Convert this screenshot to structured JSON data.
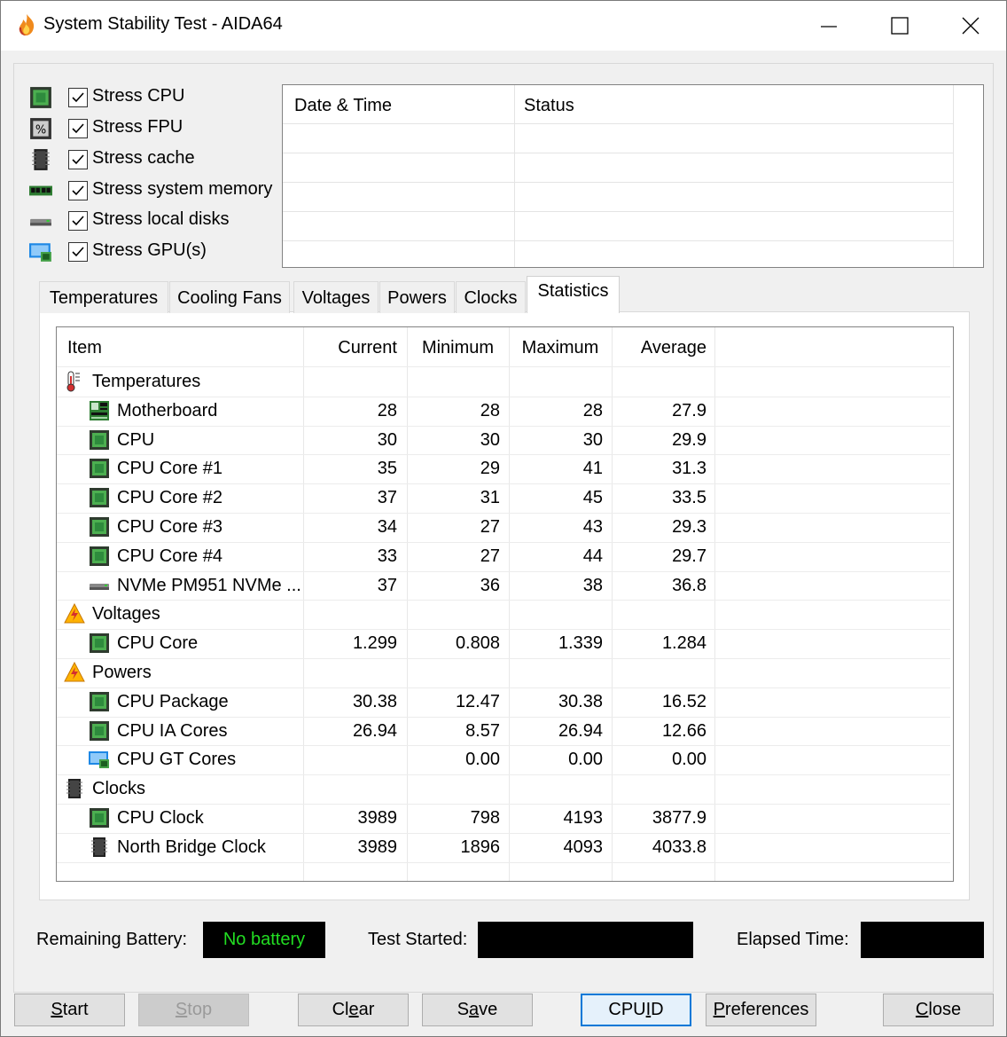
{
  "window": {
    "title": "System Stability Test - AIDA64",
    "icon": "aida64-flame-icon"
  },
  "stress_options": [
    {
      "label": "Stress CPU",
      "checked": true,
      "icon": "cpu-chip-icon"
    },
    {
      "label": "Stress FPU",
      "checked": true,
      "icon": "fpu-chip-icon"
    },
    {
      "label": "Stress cache",
      "checked": true,
      "icon": "cache-chip-icon"
    },
    {
      "label": "Stress system memory",
      "checked": true,
      "icon": "memory-module-icon"
    },
    {
      "label": "Stress local disks",
      "checked": true,
      "icon": "disk-drive-icon"
    },
    {
      "label": "Stress GPU(s)",
      "checked": true,
      "icon": "gpu-monitor-icon"
    }
  ],
  "status_log": {
    "columns": [
      "Date & Time",
      "Status"
    ],
    "rows": []
  },
  "tabs": [
    {
      "label": "Temperatures",
      "active": false
    },
    {
      "label": "Cooling Fans",
      "active": false
    },
    {
      "label": "Voltages",
      "active": false
    },
    {
      "label": "Powers",
      "active": false
    },
    {
      "label": "Clocks",
      "active": false
    },
    {
      "label": "Statistics",
      "active": true
    }
  ],
  "statistics": {
    "columns": [
      "Item",
      "Current",
      "Minimum",
      "Maximum",
      "Average"
    ],
    "rows": [
      {
        "type": "group",
        "name": "Temperatures",
        "icon": "thermometer-icon"
      },
      {
        "type": "item",
        "name": "Motherboard",
        "icon": "motherboard-icon",
        "current": "28",
        "minimum": "28",
        "maximum": "28",
        "average": "27.9"
      },
      {
        "type": "item",
        "name": "CPU",
        "icon": "cpu-chip-icon",
        "current": "30",
        "minimum": "30",
        "maximum": "30",
        "average": "29.9"
      },
      {
        "type": "item",
        "name": "CPU Core #1",
        "icon": "cpu-chip-icon",
        "current": "35",
        "minimum": "29",
        "maximum": "41",
        "average": "31.3"
      },
      {
        "type": "item",
        "name": "CPU Core #2",
        "icon": "cpu-chip-icon",
        "current": "37",
        "minimum": "31",
        "maximum": "45",
        "average": "33.5"
      },
      {
        "type": "item",
        "name": "CPU Core #3",
        "icon": "cpu-chip-icon",
        "current": "34",
        "minimum": "27",
        "maximum": "43",
        "average": "29.3"
      },
      {
        "type": "item",
        "name": "CPU Core #4",
        "icon": "cpu-chip-icon",
        "current": "33",
        "minimum": "27",
        "maximum": "44",
        "average": "29.7"
      },
      {
        "type": "item",
        "name": "NVMe PM951 NVMe ...",
        "icon": "disk-drive-icon",
        "current": "37",
        "minimum": "36",
        "maximum": "38",
        "average": "36.8"
      },
      {
        "type": "group",
        "name": "Voltages",
        "icon": "warning-voltage-icon"
      },
      {
        "type": "item",
        "name": "CPU Core",
        "icon": "cpu-chip-icon",
        "current": "1.299",
        "minimum": "0.808",
        "maximum": "1.339",
        "average": "1.284"
      },
      {
        "type": "group",
        "name": "Powers",
        "icon": "warning-voltage-icon"
      },
      {
        "type": "item",
        "name": "CPU Package",
        "icon": "cpu-chip-icon",
        "current": "30.38",
        "minimum": "12.47",
        "maximum": "30.38",
        "average": "16.52"
      },
      {
        "type": "item",
        "name": "CPU IA Cores",
        "icon": "cpu-chip-icon",
        "current": "26.94",
        "minimum": "8.57",
        "maximum": "26.94",
        "average": "12.66"
      },
      {
        "type": "item",
        "name": "CPU GT Cores",
        "icon": "gpu-monitor-icon",
        "current": "",
        "minimum": "0.00",
        "maximum": "0.00",
        "average": "0.00"
      },
      {
        "type": "group",
        "name": "Clocks",
        "icon": "clock-chip-icon"
      },
      {
        "type": "item",
        "name": "CPU Clock",
        "icon": "cpu-chip-icon",
        "current": "3989",
        "minimum": "798",
        "maximum": "4193",
        "average": "3877.9"
      },
      {
        "type": "item",
        "name": "North Bridge Clock",
        "icon": "cache-chip-icon",
        "current": "3989",
        "minimum": "1896",
        "maximum": "4093",
        "average": "4033.8"
      }
    ]
  },
  "footer": {
    "remaining_battery_label": "Remaining Battery:",
    "battery_value": "No battery",
    "test_started_label": "Test Started:",
    "test_started_value": "",
    "elapsed_time_label": "Elapsed Time:",
    "elapsed_time_value": ""
  },
  "buttons": {
    "start": {
      "accel": "S",
      "rest": "tart"
    },
    "stop": {
      "accel": "S",
      "rest": "top"
    },
    "clear": {
      "pre": "Cl",
      "accel": "e",
      "rest": "ar"
    },
    "save": {
      "pre": "S",
      "accel": "a",
      "rest": "ve"
    },
    "cpuid": {
      "pre": "CPU",
      "accel": "I",
      "rest": "D"
    },
    "preferences": {
      "accel": "P",
      "rest": "references"
    },
    "close": {
      "accel": "C",
      "rest": "lose"
    }
  },
  "colors": {
    "battery_text": "#22dd22",
    "default_button_border": "#0078d7",
    "chip_green": "#2e8b3d"
  }
}
